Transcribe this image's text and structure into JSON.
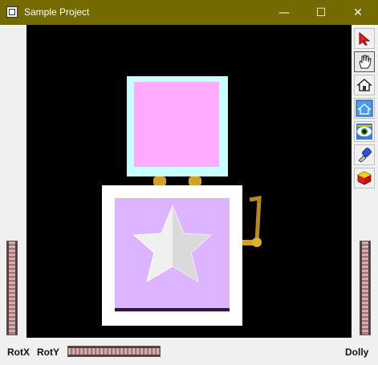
{
  "window": {
    "title": "Sample Project",
    "minimize_glyph": "—",
    "maximize_glyph": "☐",
    "close_glyph": "✕"
  },
  "toolbar": {
    "tools": [
      {
        "name": "select-arrow-icon",
        "active": false
      },
      {
        "name": "hand-icon",
        "active": true
      },
      {
        "name": "home-icon",
        "active": false
      },
      {
        "name": "set-home-icon",
        "active": false
      },
      {
        "name": "view-all-icon",
        "active": false
      },
      {
        "name": "seek-icon",
        "active": false
      },
      {
        "name": "projection-icon",
        "active": false
      }
    ]
  },
  "controls": {
    "rotx_label": "RotX",
    "roty_label": "RotY",
    "dolly_label": "Dolly"
  },
  "colors": {
    "title_bar": "#736a00",
    "viewport_bg": "#000000",
    "box_lid_fill": "#ffaaff",
    "box_lid_frame": "#c8ffff",
    "box_front": "#ddb4ff",
    "box_frame": "#ffffff",
    "crank": "#d4a020"
  }
}
